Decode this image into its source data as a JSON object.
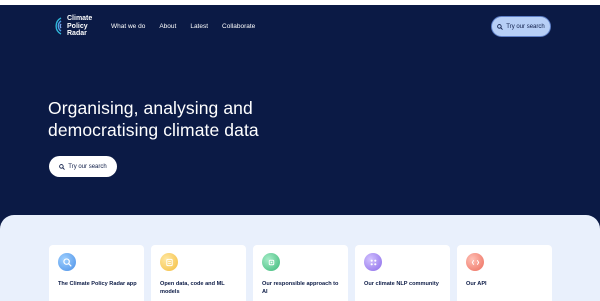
{
  "header": {
    "logo_lines": [
      "Climate",
      "Policy",
      "Radar"
    ],
    "nav": [
      "What we do",
      "About",
      "Latest",
      "Collaborate"
    ],
    "search_button": "Try our search"
  },
  "hero": {
    "headline_lines": [
      "Organising, analysing and",
      "democratising climate data"
    ],
    "search_button": "Try our search"
  },
  "cards": [
    {
      "title": "The Climate Policy Radar app",
      "icon": "search-icon",
      "color": "#5aa6f0"
    },
    {
      "title": "Open data, code and ML models",
      "icon": "code-icon",
      "color": "#f6c64e"
    },
    {
      "title": "Our responsible approach to AI",
      "icon": "ai-icon",
      "color": "#45c387"
    },
    {
      "title": "Our climate NLP community",
      "icon": "community-icon",
      "color": "#9b7cf0"
    },
    {
      "title": "Our API",
      "icon": "api-icon",
      "color": "#f07c6c"
    }
  ],
  "colors": {
    "hero_bg": "#0b1a45",
    "panel_bg": "#e9f0fc",
    "button_light": "#b7cff6"
  }
}
